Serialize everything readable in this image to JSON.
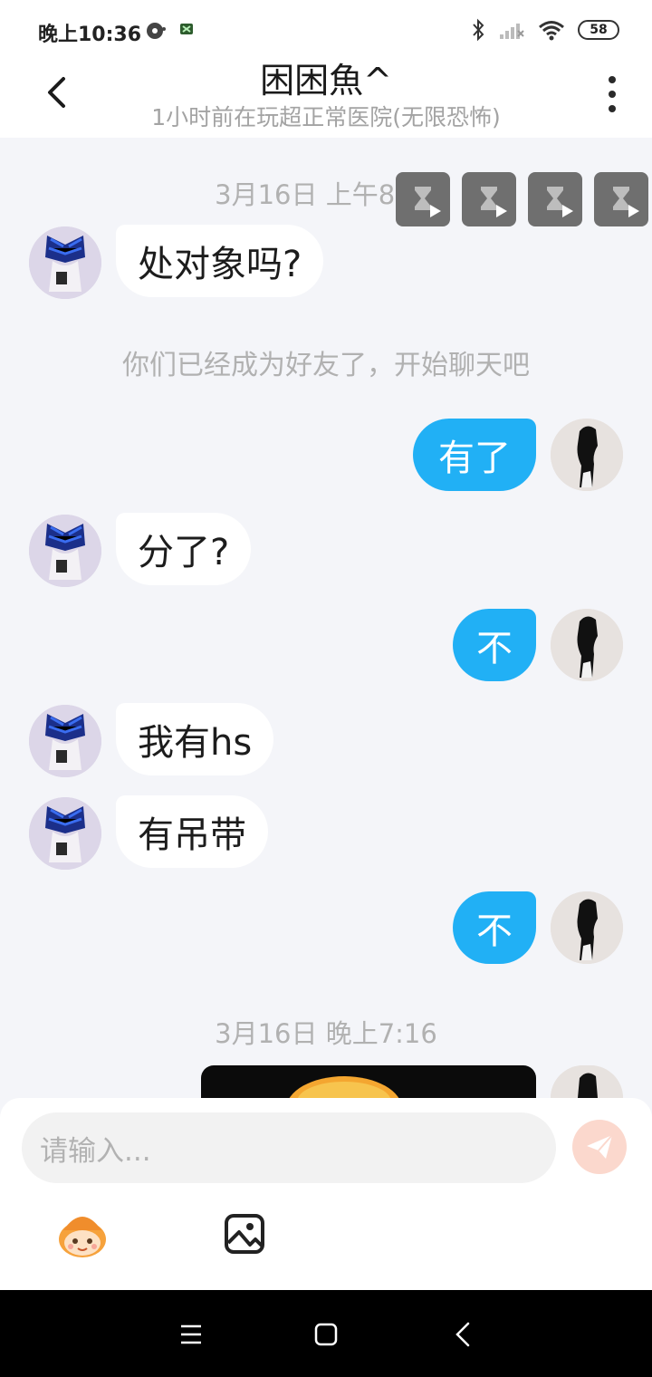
{
  "status_bar": {
    "time": "晚上10:36",
    "battery": "58"
  },
  "header": {
    "title": "困困魚^",
    "subtitle": "1小时前在玩超正常医院(无限恐怖)"
  },
  "chat": {
    "timestamps": [
      "3月16日 上午8:28",
      "3月16日 晚上7:16"
    ],
    "system_message": "你们已经成为好友了，开始聊天吧",
    "messages": [
      {
        "from": "them",
        "text": "处对象吗?"
      },
      {
        "from": "me",
        "text": "有了"
      },
      {
        "from": "them",
        "text": "分了?"
      },
      {
        "from": "me",
        "text": "不"
      },
      {
        "from": "them",
        "text": "我有hs"
      },
      {
        "from": "them",
        "text": "有吊带"
      },
      {
        "from": "me",
        "text": "不"
      }
    ]
  },
  "composer": {
    "placeholder": "请输入..."
  },
  "icons": {
    "back": "back-arrow-icon",
    "more": "more-vertical-icon",
    "send": "send-paper-plane-icon",
    "emoji": "emoji-face-icon",
    "gallery": "image-gallery-icon"
  },
  "colors": {
    "accent": "#21b0f5",
    "background": "#f4f5f9",
    "send_disabled": "#fbd8cd"
  }
}
